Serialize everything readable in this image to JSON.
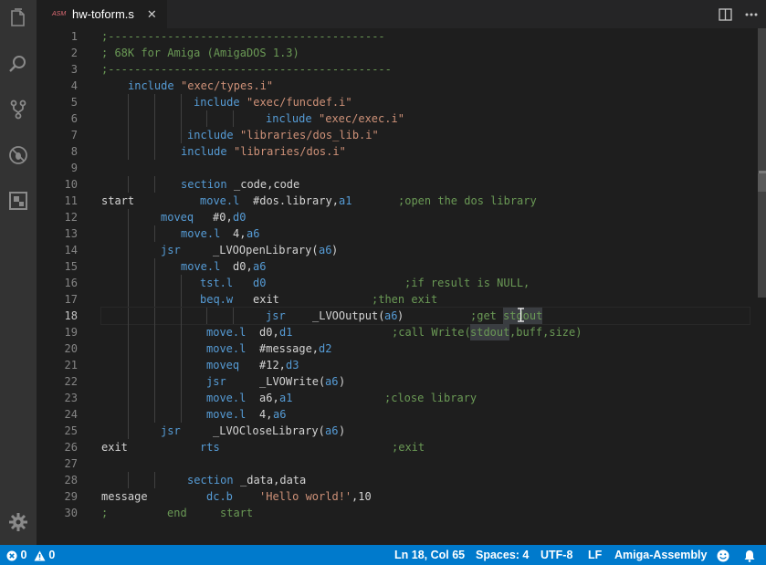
{
  "tab": {
    "icon_text": "ASM",
    "label": "hw-toform.s",
    "close": "✕"
  },
  "gutter": {
    "lines": [
      "1",
      "2",
      "3",
      "4",
      "5",
      "6",
      "7",
      "8",
      "9",
      "10",
      "11",
      "12",
      "13",
      "14",
      "15",
      "16",
      "17",
      "18",
      "19",
      "20",
      "21",
      "22",
      "23",
      "24",
      "25",
      "26",
      "27",
      "28",
      "29",
      "30"
    ],
    "active_line": 18
  },
  "code": {
    "l1": {
      "comment": ";------------------------------------------"
    },
    "l2": {
      "comment": "; 68K for Amiga (AmigaDOS 1.3)"
    },
    "l3": {
      "comment": ";-------------------------------------------"
    },
    "l4": {
      "kw": "include",
      "str": "\"exec/types.i\""
    },
    "l5": {
      "kw": "include",
      "str": "\"exec/funcdef.i\""
    },
    "l6": {
      "kw": "include",
      "str": "\"exec/exec.i\""
    },
    "l7": {
      "kw": "include",
      "str": "\"libraries/dos_lib.i\""
    },
    "l8": {
      "kw": "include",
      "str": "\"libraries/dos.i\""
    },
    "l10": {
      "kw": "section",
      "args": "_code,code"
    },
    "l11": {
      "label": "start",
      "kw": "move.l",
      "args": "#dos.library,",
      "reg": "a1",
      "comment": ";open the dos library"
    },
    "l12": {
      "kw": "moveq",
      "args": "#0,",
      "reg": "d0"
    },
    "l13": {
      "kw": "move.l",
      "args": "4,",
      "reg": "a6"
    },
    "l14": {
      "kw": "jsr",
      "args": "_LVOOpenLibrary(",
      "reg": "a6",
      "tail": ")"
    },
    "l15": {
      "kw": "move.l",
      "args": "d0,",
      "reg": "a6"
    },
    "l16": {
      "kw": "tst.l",
      "reg": "d0",
      "comment": ";if result is NULL,"
    },
    "l17": {
      "kw": "beq.w",
      "args": "exit",
      "comment": ";then exit"
    },
    "l18": {
      "kw": "jsr",
      "args": "_LVOOutput(",
      "reg": "a6",
      "tail": ")",
      "comment": ";get ",
      "comment_hl": "stdout"
    },
    "l19": {
      "kw": "move.l",
      "args": "d0,",
      "reg": "d1",
      "comment": ";call Write(",
      "comment_hl": "stdout",
      "comment_tail": ",buff,size)"
    },
    "l20": {
      "kw": "move.l",
      "args": "#message,",
      "reg": "d2"
    },
    "l21": {
      "kw": "moveq",
      "args": "#12,",
      "reg": "d3"
    },
    "l22": {
      "kw": "jsr",
      "args": "_LVOWrite(",
      "reg": "a6",
      "tail": ")"
    },
    "l23": {
      "kw": "move.l",
      "args": "a6,",
      "reg": "a1",
      "comment": ";close library"
    },
    "l24": {
      "kw": "move.l",
      "args": "4,",
      "reg": "a6"
    },
    "l25": {
      "kw": "jsr",
      "args": "_LVOCloseLibrary(",
      "reg": "a6",
      "tail": ")"
    },
    "l26": {
      "label": "exit",
      "kw": "rts",
      "comment": ";exit"
    },
    "l28": {
      "kw": "section",
      "args": "_data,data"
    },
    "l29": {
      "label": "message",
      "kw": "dc.b",
      "str": "'Hello world!'",
      "args": ",10"
    },
    "l30": {
      "comment1": ";",
      "comment2": "end",
      "comment3": "start"
    }
  },
  "status": {
    "errors": "0",
    "warnings": "0",
    "position": "Ln 18, Col 65",
    "spaces": "Spaces: 4",
    "encoding": "UTF-8",
    "eol": "LF",
    "language": "Amiga-Assembly"
  },
  "icons": {
    "activity": [
      "files-icon",
      "search-icon",
      "source-control-icon",
      "debug-icon",
      "extensions-icon",
      "settings-gear-icon"
    ],
    "toolbar": [
      "split-editor-icon",
      "more-actions-icon"
    ],
    "status": [
      "error-icon",
      "warning-icon",
      "feedback-smiley-icon",
      "notification-bell-icon"
    ]
  },
  "colors": {
    "statusbar": "#007acc",
    "activity_bar": "#333333",
    "editor_bg": "#1e1e1e",
    "comment": "#6a9955",
    "keyword": "#569cd6",
    "string": "#ce9178"
  }
}
